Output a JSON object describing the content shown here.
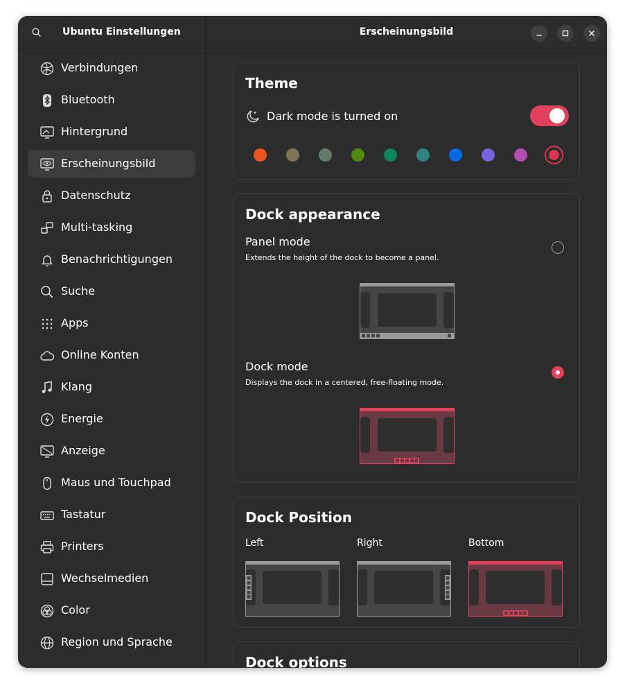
{
  "sidebar": {
    "title": "Ubuntu Einstellungen",
    "items": [
      {
        "label": "Verbindungen",
        "icon": "network-icon"
      },
      {
        "label": "Bluetooth",
        "icon": "bluetooth-icon"
      },
      {
        "label": "Hintergrund",
        "icon": "background-icon"
      },
      {
        "label": "Erscheinungsbild",
        "icon": "appearance-icon",
        "active": true
      },
      {
        "label": "Datenschutz",
        "icon": "lock-icon"
      },
      {
        "label": "Multi-tasking",
        "icon": "multitasking-icon"
      },
      {
        "label": "Benachrichtigungen",
        "icon": "bell-icon"
      },
      {
        "label": "Suche",
        "icon": "search-icon"
      },
      {
        "label": "Apps",
        "icon": "apps-grid-icon"
      },
      {
        "label": "Online Konten",
        "icon": "cloud-icon"
      },
      {
        "label": "Klang",
        "icon": "music-note-icon"
      },
      {
        "label": "Energie",
        "icon": "power-icon"
      },
      {
        "label": "Anzeige",
        "icon": "display-icon"
      },
      {
        "label": "Maus und Touchpad",
        "icon": "mouse-icon"
      },
      {
        "label": "Tastatur",
        "icon": "keyboard-icon"
      },
      {
        "label": "Printers",
        "icon": "printer-icon"
      },
      {
        "label": "Wechselmedien",
        "icon": "removable-media-icon"
      },
      {
        "label": "Color",
        "icon": "color-icon"
      },
      {
        "label": "Region und Sprache",
        "icon": "globe-icon"
      }
    ]
  },
  "header": {
    "title": "Erscheinungsbild"
  },
  "theme": {
    "title": "Theme",
    "dark_mode_label": "Dark mode is turned on",
    "dark_mode_on": true,
    "accent_colors": [
      "#e95420",
      "#7c7656",
      "#657b69",
      "#4e8a0c",
      "#0d8759",
      "#308380",
      "#0969e0",
      "#7764d8",
      "#b34cb3",
      "#da3450"
    ],
    "selected_accent": "#da3450"
  },
  "dock_appearance": {
    "title": "Dock appearance",
    "panel_mode_title": "Panel mode",
    "panel_mode_desc": "Extends the height of the dock to become a panel.",
    "dock_mode_title": "Dock mode",
    "dock_mode_desc": "Displays the dock in a centered, free-floating mode.",
    "selected": "dock"
  },
  "dock_position": {
    "title": "Dock Position",
    "options": [
      "Left",
      "Right",
      "Bottom"
    ],
    "selected": "Bottom"
  },
  "dock_options": {
    "title": "Dock options"
  },
  "colors": {
    "accent": "#e0405c",
    "window_bg": "#2c2c2c",
    "text": "#ffffff"
  }
}
